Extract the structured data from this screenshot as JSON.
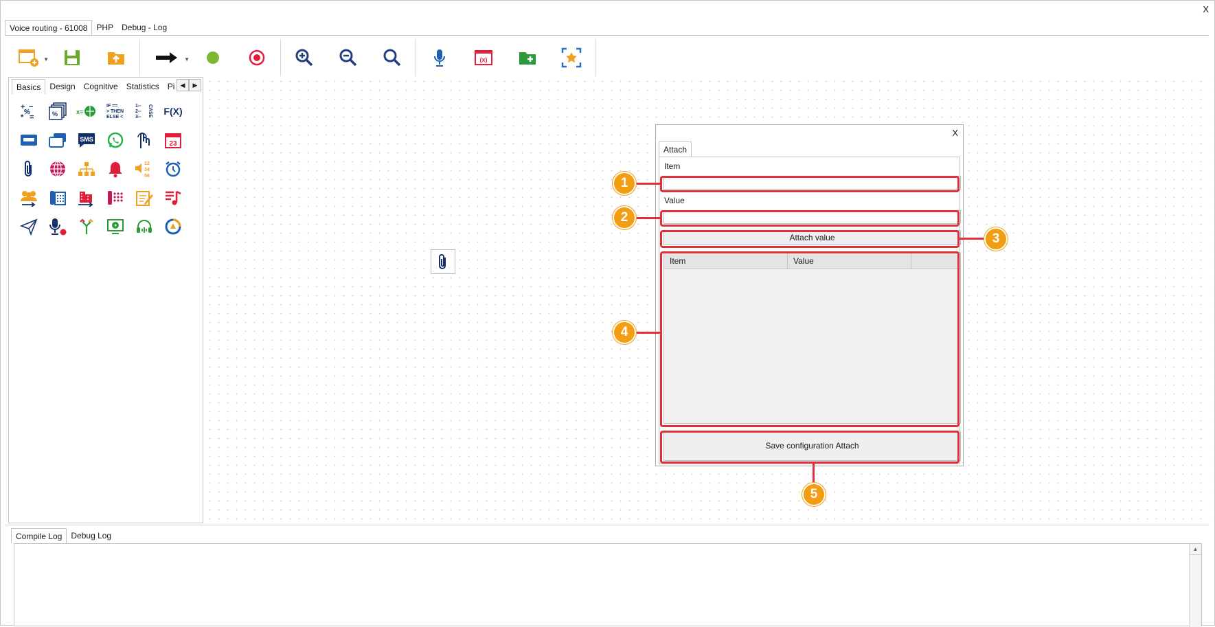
{
  "window": {
    "close_label": "X"
  },
  "top_tabs": [
    "Voice routing - 61008",
    "PHP",
    "Debug - Log"
  ],
  "toolbar": {
    "items": [
      "new-flow-icon",
      "save-icon",
      "export-icon",
      "arrow-icon",
      "start-icon",
      "stop-icon",
      "zoom-in-icon",
      "zoom-out-icon",
      "zoom-fit-icon",
      "microphone-icon",
      "variables-icon",
      "add-folder-icon",
      "auto-layout-icon"
    ]
  },
  "palette": {
    "tabs": [
      "Basics",
      "Design",
      "Cognitive",
      "Statistics",
      "Pi"
    ],
    "texts": {
      "ifthen": "IF ==\n> THEN\nELSE <",
      "fx": "F(X)",
      "sms": "SMS",
      "calendar": "23",
      "case": "CASE"
    }
  },
  "dialog": {
    "close_label": "X",
    "tab_label": "Attach",
    "item_label": "Item",
    "item_value": "",
    "value_label": "Value",
    "value_value": "",
    "attach_button": "Attach value",
    "grid_headers": [
      "Item",
      "Value",
      ""
    ],
    "save_button": "Save configuration Attach"
  },
  "callouts": [
    "1",
    "2",
    "3",
    "4",
    "5"
  ],
  "log": {
    "tabs": [
      "Compile Log",
      "Debug Log"
    ],
    "content": ""
  },
  "colors": {
    "highlight": "#e0313a",
    "callout": "#f29d12",
    "green": "#6aaa2a",
    "orange": "#f0a020",
    "blue": "#1f4fa0",
    "red": "#e01e3c"
  }
}
